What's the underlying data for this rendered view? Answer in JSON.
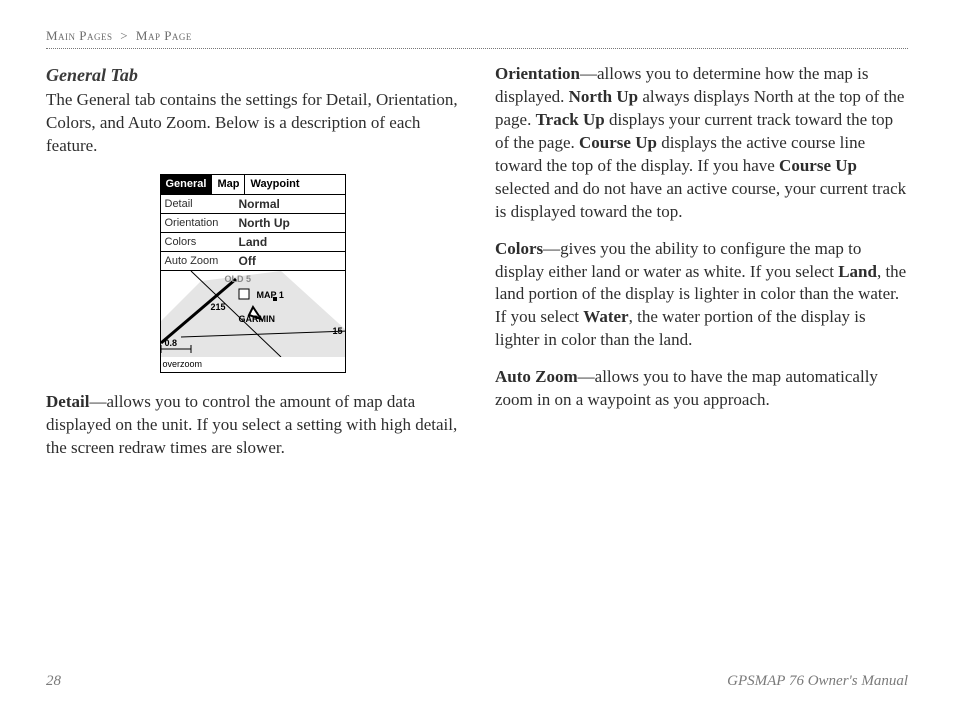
{
  "breadcrumb": {
    "a": "Main Pages",
    "sep": ">",
    "b": "Map Page"
  },
  "left": {
    "heading": "General Tab",
    "intro": "The General tab contains the settings for Detail, Orientation, Colors, and Auto Zoom. Below is a description of each feature.",
    "detail_label": "Detail",
    "detail_body": "—allows you to control the amount of map data displayed on the unit. If you select a setting with high detail, the screen redraw times are slower."
  },
  "right": {
    "orientation_label": "Orientation",
    "orientation_body_1": "—allows you to determine how the map is displayed. ",
    "north_up": "North Up",
    "orientation_body_2": " always displays North at the top of the page. ",
    "track_up": "Track Up",
    "orientation_body_3": " displays your current track toward the top of the page. ",
    "course_up": "Course Up",
    "orientation_body_4": " displays the active course line toward the top of the display. If you have ",
    "course_up2": "Course Up",
    "orientation_body_5": " selected and do not have an active course, your current track is displayed toward the top.",
    "colors_label": "Colors",
    "colors_body_1": "—gives you the ability to configure the map to display either land or water as white. If you select ",
    "land": "Land",
    "colors_body_2": ", the land portion of the display is lighter in color than the water. If you select ",
    "water": "Water",
    "colors_body_3": ", the water portion of the display is lighter in color than the land.",
    "autozoom_label": "Auto Zoom",
    "autozoom_body": "—allows you to have the map automatically zoom in on a waypoint as you approach."
  },
  "figure": {
    "tabs": {
      "general": "General",
      "map": "Map",
      "waypoint": "Waypoint"
    },
    "rows": {
      "detail_l": "Detail",
      "detail_v": "Normal",
      "orient_l": "Orientation",
      "orient_v": "North Up",
      "colors_l": "Colors",
      "colors_v": "Land",
      "zoom_l": "Auto Zoom",
      "zoom_v": "Off"
    },
    "map": {
      "wp": "MAP 1",
      "brand": "GARMIN",
      "dist": "215",
      "scale": "0.8",
      "right": "15",
      "old": "OLD 5",
      "overzoom": "overzoom"
    }
  },
  "footer": {
    "page": "28",
    "doc": "GPSMAP 76 Owner's Manual"
  }
}
